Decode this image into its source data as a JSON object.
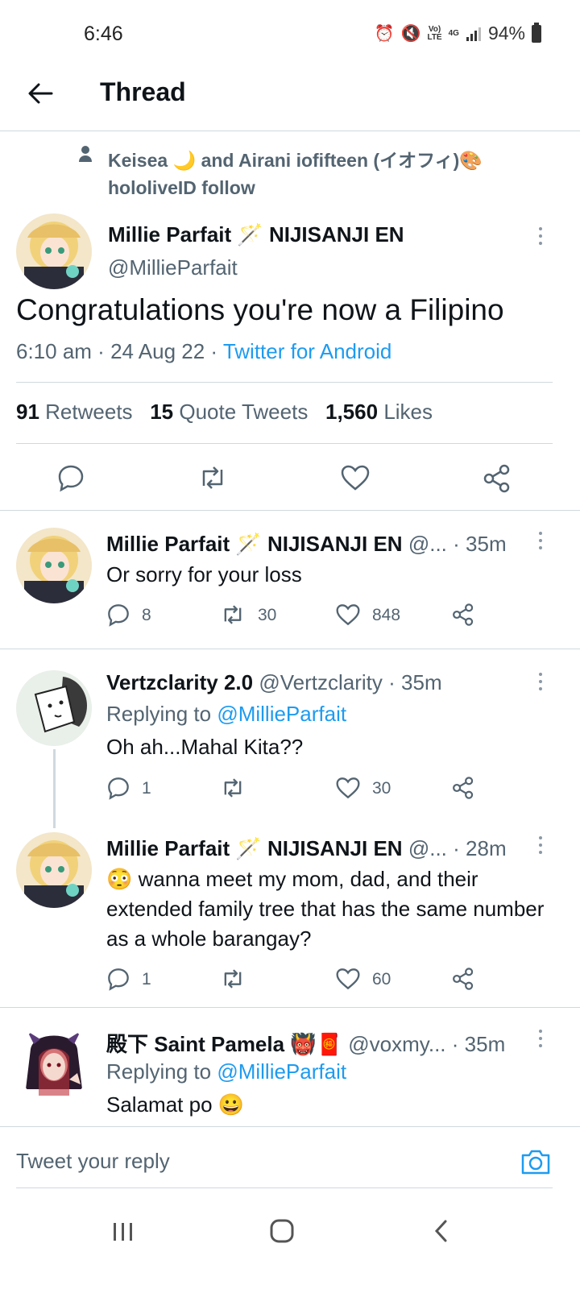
{
  "status_bar": {
    "time": "6:46",
    "battery": "94%",
    "network": "4G",
    "lte_top": "Vo)",
    "lte_bottom": "LTE"
  },
  "header": {
    "title": "Thread"
  },
  "social_context": {
    "text": "Keisea 🌙 and Airani iofifteen (イオフィ)🎨 hololiveID follow"
  },
  "main_tweet": {
    "display_name": "Millie Parfait 🪄 NIJISANJI EN",
    "handle": "@MillieParfait",
    "text": "Congratulations you're now a Filipino",
    "time": "6:10 am",
    "date": "24 Aug 22",
    "source": "Twitter for Android",
    "retweets_count": "91",
    "retweets_label": "Retweets",
    "quotes_count": "15",
    "quotes_label": "Quote Tweets",
    "likes_count": "1,560",
    "likes_label": "Likes"
  },
  "replies": [
    {
      "display_name": "Millie Parfait 🪄 NIJISANJI EN",
      "handle": "@...",
      "time": "· 35m",
      "text": "Or sorry for your loss",
      "reply_count": "8",
      "retweet_count": "30",
      "like_count": "848"
    },
    {
      "display_name": "Vertzclarity 2.0",
      "handle": "@Vertzclarity",
      "time": "· 35m",
      "replying_prefix": "Replying to",
      "replying_to": "@MillieParfait",
      "text": "Oh ah...Mahal Kita??",
      "reply_count": "1",
      "retweet_count": "",
      "like_count": "30"
    },
    {
      "display_name": "Millie Parfait 🪄 NIJISANJI EN",
      "handle": "@...",
      "time": "· 28m",
      "text": "😳 wanna meet my mom, dad, and their extended family tree that has the same number as a whole barangay?",
      "reply_count": "1",
      "retweet_count": "",
      "like_count": "60"
    },
    {
      "display_name": "殿下 Saint Pamela 👹🧧",
      "handle": "@voxmy...",
      "time": "· 35m",
      "replying_prefix": "Replying to",
      "replying_to": "@MillieParfait",
      "text": "Salamat po 😀"
    }
  ],
  "reply_bar": {
    "placeholder": "Tweet your reply"
  },
  "colors": {
    "accent": "#1d9bf0",
    "muted": "#536471",
    "divider": "#cfd9de"
  }
}
